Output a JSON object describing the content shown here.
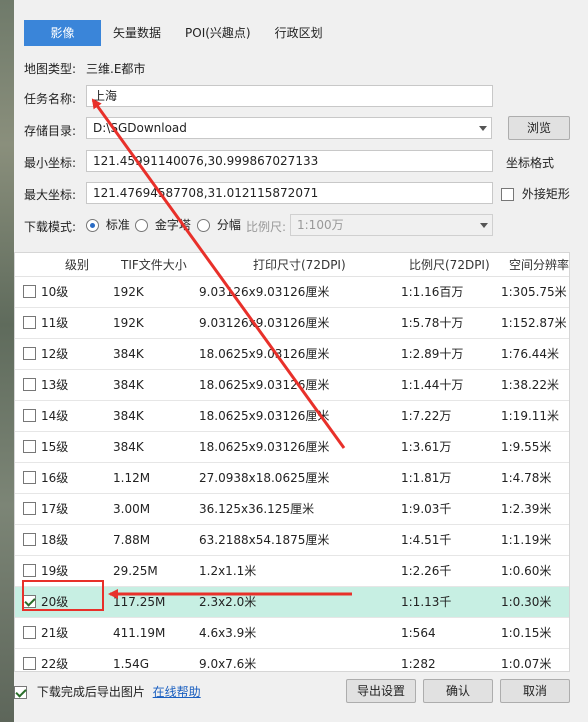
{
  "tabs": [
    {
      "label": "影像",
      "active": true
    },
    {
      "label": "矢量数据",
      "active": false
    },
    {
      "label": "POI(兴趣点)",
      "active": false
    },
    {
      "label": "行政区划",
      "active": false
    }
  ],
  "map_type": {
    "label": "地图类型:",
    "value": "三维.E都市"
  },
  "task_name": {
    "label": "任务名称:",
    "value": "上海"
  },
  "storage_dir": {
    "label": "存储目录:",
    "value": "D:\\SGDownload",
    "browse_button": "浏览"
  },
  "min_coord": {
    "label": "最小坐标:",
    "value": "121.45991140076,30.999867027133",
    "format_label": "坐标格式"
  },
  "max_coord": {
    "label": "最大坐标:",
    "value": "121.47694587708,31.012115872071",
    "bounding_rect_label": "外接矩形",
    "bounding_rect_checked": false
  },
  "download_mode": {
    "label": "下载模式:",
    "options": [
      {
        "label": "标准",
        "selected": true
      },
      {
        "label": "金字塔",
        "selected": false
      },
      {
        "label": "分幅",
        "selected": false
      }
    ],
    "scale_label": "比例尺:",
    "scale_value": "1:100万"
  },
  "table": {
    "headers": [
      "级别",
      "TIF文件大小",
      "打印尺寸(72DPI)",
      "比例尺(72DPI)",
      "空间分辨率"
    ],
    "rows": [
      {
        "checked": false,
        "level": "10级",
        "size": "192K",
        "print": "9.03126x9.03126厘米",
        "scale": "1:1.16百万",
        "res": "1:305.75米"
      },
      {
        "checked": false,
        "level": "11级",
        "size": "192K",
        "print": "9.03126x9.03126厘米",
        "scale": "1:5.78十万",
        "res": "1:152.87米"
      },
      {
        "checked": false,
        "level": "12级",
        "size": "384K",
        "print": "18.0625x9.03126厘米",
        "scale": "1:2.89十万",
        "res": "1:76.44米"
      },
      {
        "checked": false,
        "level": "13级",
        "size": "384K",
        "print": "18.0625x9.03126厘米",
        "scale": "1:1.44十万",
        "res": "1:38.22米"
      },
      {
        "checked": false,
        "level": "14级",
        "size": "384K",
        "print": "18.0625x9.03126厘米",
        "scale": "1:7.22万",
        "res": "1:19.11米"
      },
      {
        "checked": false,
        "level": "15级",
        "size": "384K",
        "print": "18.0625x9.03126厘米",
        "scale": "1:3.61万",
        "res": "1:9.55米"
      },
      {
        "checked": false,
        "level": "16级",
        "size": "1.12M",
        "print": "27.0938x18.0625厘米",
        "scale": "1:1.81万",
        "res": "1:4.78米"
      },
      {
        "checked": false,
        "level": "17级",
        "size": "3.00M",
        "print": "36.125x36.125厘米",
        "scale": "1:9.03千",
        "res": "1:2.39米"
      },
      {
        "checked": false,
        "level": "18级",
        "size": "7.88M",
        "print": "63.2188x54.1875厘米",
        "scale": "1:4.51千",
        "res": "1:1.19米"
      },
      {
        "checked": false,
        "level": "19级",
        "size": "29.25M",
        "print": "1.2x1.1米",
        "scale": "1:2.26千",
        "res": "1:0.60米"
      },
      {
        "checked": true,
        "level": "20级",
        "size": "117.25M",
        "print": "2.3x2.0米",
        "scale": "1:1.13千",
        "res": "1:0.30米"
      },
      {
        "checked": false,
        "level": "21级",
        "size": "411.19M",
        "print": "4.6x3.9米",
        "scale": "1:564",
        "res": "1:0.15米"
      },
      {
        "checked": false,
        "level": "22级",
        "size": "1.54G",
        "print": "9.0x7.6米",
        "scale": "1:282",
        "res": "1:0.07米"
      }
    ]
  },
  "footer": {
    "export_checkbox_label": "下载完成后导出图片",
    "export_checked": true,
    "help_link": "在线帮助",
    "export_settings_button": "导出设置",
    "ok_button": "确认",
    "cancel_button": "取消"
  },
  "colors": {
    "accent": "#3a85d9",
    "selected_row": "#c7efe3",
    "annotation_red": "#e8302a"
  }
}
